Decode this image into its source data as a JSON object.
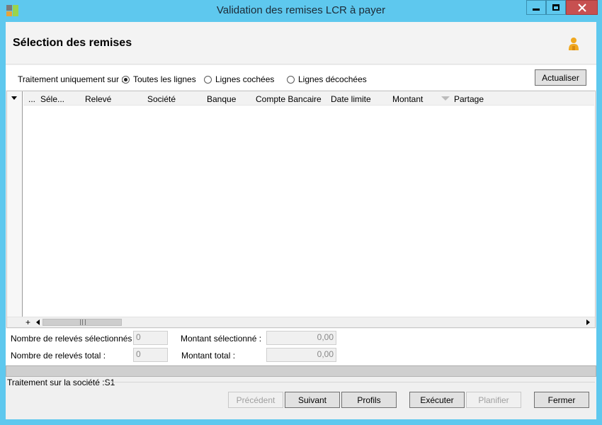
{
  "window": {
    "title": "Validation des remises LCR à payer",
    "controls": {
      "minimize": "minimize",
      "maximize": "maximize",
      "close": "close"
    },
    "accent_color": "#5ec8ee"
  },
  "header": {
    "title": "Sélection des remises",
    "icon": "user-icon"
  },
  "filter": {
    "label": "Traitement uniquement sur :",
    "options": [
      {
        "label": "Toutes les lignes",
        "selected": true
      },
      {
        "label": "Lignes cochées",
        "selected": false
      },
      {
        "label": "Lignes décochées",
        "selected": false
      }
    ],
    "refresh_button": "Actualiser"
  },
  "grid": {
    "columns": [
      "...",
      "Séle...",
      "Relevé",
      "Société",
      "Banque",
      "Compte Bancaire",
      "Date limite",
      "Montant",
      "Partage"
    ],
    "rows": [],
    "footer_add": "+"
  },
  "summary": {
    "selected_count_label": "Nombre de relevés sélectionnés :",
    "selected_count_value": "0",
    "total_count_label": "Nombre de relevés total :",
    "total_count_value": "0",
    "selected_amount_label": "Montant sélectionné :",
    "selected_amount_value": "0,00",
    "total_amount_label": "Montant total :",
    "total_amount_value": "0,00"
  },
  "status": {
    "text": "Traitement sur la société :S1"
  },
  "buttons": {
    "previous": {
      "label": "Précédent",
      "enabled": false
    },
    "next": {
      "label": "Suivant",
      "enabled": true
    },
    "profiles": {
      "label": "Profils",
      "enabled": true
    },
    "execute": {
      "label": "Exécuter",
      "enabled": true
    },
    "schedule": {
      "label": "Planifier",
      "enabled": false
    },
    "close": {
      "label": "Fermer",
      "enabled": true
    }
  }
}
